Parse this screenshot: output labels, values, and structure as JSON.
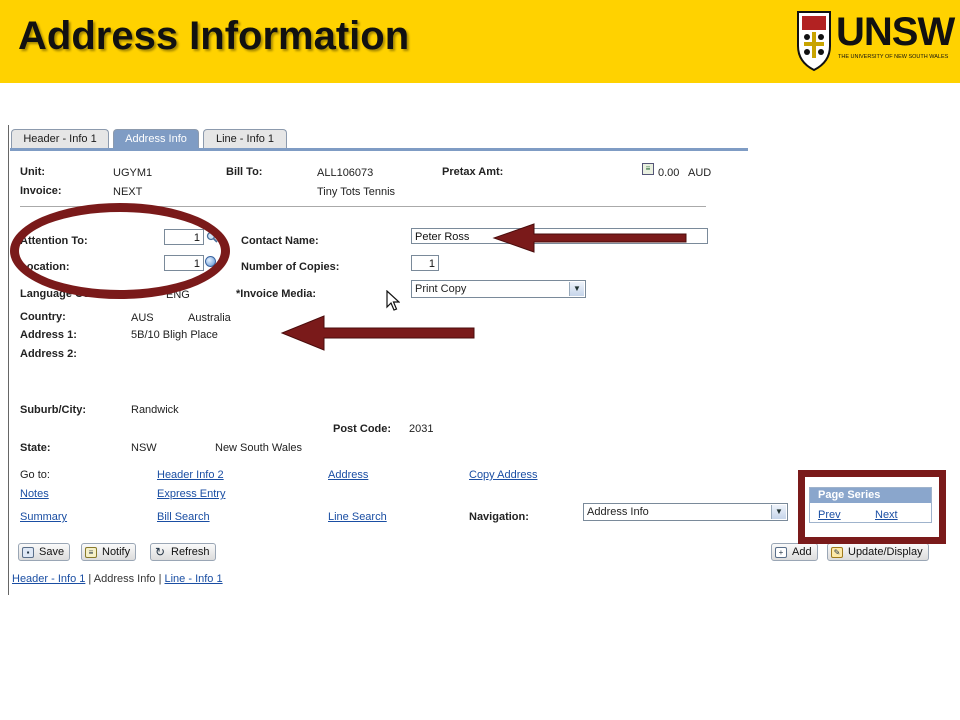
{
  "slide": {
    "title": "Address Information"
  },
  "logo": {
    "word": "UNSW",
    "subtitle": "THE UNIVERSITY OF NEW SOUTH WALES"
  },
  "tabs": [
    {
      "label": "Header - Info 1"
    },
    {
      "label": "Address Info"
    },
    {
      "label": "Line - Info 1"
    }
  ],
  "header": {
    "unit_label": "Unit:",
    "unit_value": "UGYM1",
    "invoice_label": "Invoice:",
    "invoice_value": "NEXT",
    "bill_to_label": "Bill To:",
    "bill_to_value": "ALL106073",
    "bill_to_name": "Tiny Tots Tennis",
    "pretax_label": "Pretax Amt:",
    "pretax_value": "0.00",
    "pretax_currency": "AUD"
  },
  "form": {
    "attention_label": "Attention To:",
    "attention_value": "1",
    "location_label": "Location:",
    "location_value": "1",
    "language_label": "Language Code:",
    "language_value": "ENG",
    "contact_label": "Contact Name:",
    "contact_value": "Peter Ross",
    "copies_label": "Number of Copies:",
    "copies_value": "1",
    "media_label": "*Invoice Media:",
    "media_value": "Print Copy"
  },
  "address": {
    "country_label": "Country:",
    "country_code": "AUS",
    "country_name": "Australia",
    "address1_label": "Address 1:",
    "address1_value": "5B/10 Bligh Place",
    "address2_label": "Address 2:",
    "suburb_label": "Suburb/City:",
    "suburb_value": "Randwick",
    "postcode_label": "Post Code:",
    "postcode_value": "2031",
    "state_label": "State:",
    "state_code": "NSW",
    "state_name": "New South Wales"
  },
  "goto": {
    "label": "Go to:",
    "header_info2": "Header Info 2",
    "address": "Address",
    "copy_address": "Copy Address",
    "notes": "Notes",
    "express_entry": "Express Entry",
    "summary": "Summary",
    "bill_search": "Bill Search",
    "line_search": "Line Search",
    "navigation_label": "Navigation:",
    "navigation_value": "Address Info"
  },
  "page_series": {
    "title": "Page Series",
    "prev": "Prev",
    "next": "Next"
  },
  "toolbar": {
    "save": "Save",
    "notify": "Notify",
    "refresh": "Refresh",
    "add": "Add",
    "update_display": "Update/Display"
  },
  "footer_nav": {
    "link1": "Header - Info 1",
    "sep": " | ",
    "current": "Address Info",
    "link3": "Line - Info 1"
  },
  "colors": {
    "banner": "#ffd200",
    "annotation": "#7a1a1a",
    "tab_active": "#7f9cc4",
    "link": "#1a4ea3"
  }
}
